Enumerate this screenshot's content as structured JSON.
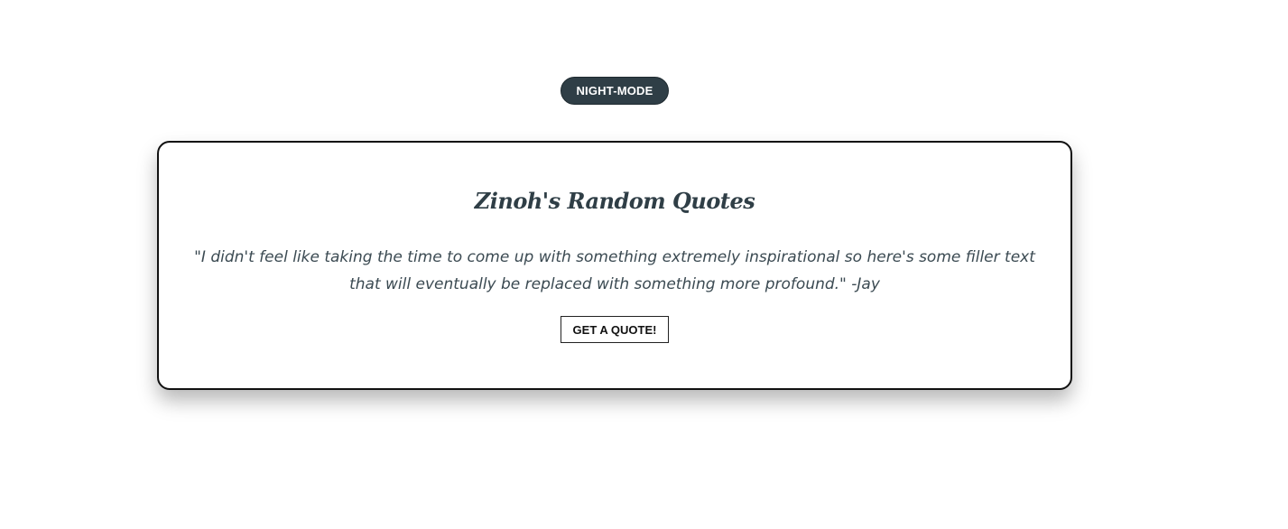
{
  "header": {
    "night_mode_label": "NIGHT-MODE"
  },
  "card": {
    "title": "Zinoh's Random Quotes",
    "quote": "\"I didn't feel like taking the time to come up with something extremely inspirational so here's some filler text that will eventually be replaced with something more profound.\" -Jay",
    "button_label": "GET A QUOTE!"
  },
  "colors": {
    "accent": "#2f3e46",
    "background": "#ffffff",
    "card_border": "#111111"
  }
}
